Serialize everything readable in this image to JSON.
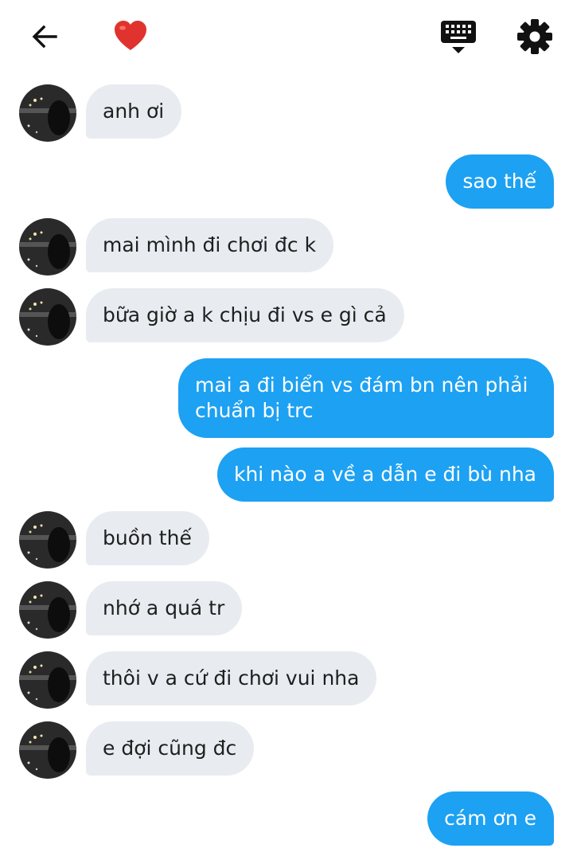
{
  "header": {
    "back_icon": "arrow-left",
    "heart_emoji": "red-heart",
    "keyboard_icon": "keyboard-hide",
    "settings_icon": "gear"
  },
  "colors": {
    "sent_bubble": "#1da1f2",
    "received_bubble": "#e8ecf0"
  },
  "messages": [
    {
      "from": "them",
      "text": "anh ơi"
    },
    {
      "from": "me",
      "text": "sao thế"
    },
    {
      "from": "them",
      "text": "mai mình đi chơi đc k"
    },
    {
      "from": "them",
      "text": "bữa giờ a k chịu đi vs e gì cả"
    },
    {
      "from": "me",
      "text": "mai a đi biển vs đám bn nên phải chuẩn bị trc"
    },
    {
      "from": "me",
      "text": "khi nào a về a dẫn e đi bù nha"
    },
    {
      "from": "them",
      "text": "buồn thế"
    },
    {
      "from": "them",
      "text": "nhớ a quá tr"
    },
    {
      "from": "them",
      "text": "thôi v a cứ đi chơi vui nha"
    },
    {
      "from": "them",
      "text": "e đợi cũng đc"
    },
    {
      "from": "me",
      "text": "cám ơn e"
    }
  ]
}
